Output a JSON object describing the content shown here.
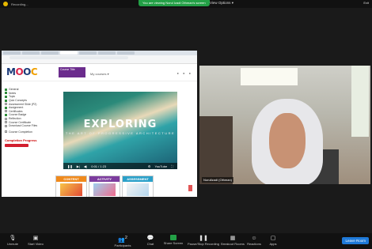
{
  "topbar": {
    "recording": "Recording...",
    "viewing_notice": "You are viewing Norul Izadi Othman's screen",
    "view_options": "View Options",
    "right_text": "Exit"
  },
  "shared_screen": {
    "logo": {
      "m": "M",
      "o": "O",
      "o2": "O",
      "c": "C"
    },
    "course_title": "Course Title",
    "nav_select": "My courses",
    "header_icons": "● ● ●",
    "sidebar_items": [
      "General",
      "Notes",
      "Topic",
      "Quiz Concepts",
      "Assessment Slide (P2)",
      "Assignment",
      "Certificates",
      "Course Badge",
      "Reflection",
      "Course Certificate",
      "Download Course Files"
    ],
    "sidebar_done": [
      true,
      true,
      true,
      true,
      false,
      true,
      false,
      true,
      false,
      false,
      false
    ],
    "sidebar_footer": "Course Completion",
    "completion_title": "Completion Progress",
    "video": {
      "title": "EXPLORING",
      "subtitle": "THE ART OF PROGRESSIVE ARCHITECTURE",
      "time": "0:01 / 1:23",
      "brand": "YouTube"
    },
    "cards": [
      "CONTENT",
      "ACTIVITY",
      "ASSESSMENT"
    ]
  },
  "camera": {
    "name": "NurulIzadi (Othman)"
  },
  "bottom_bar": {
    "unmute": "Unmute",
    "start_video": "Start Video",
    "participants": "Participants",
    "participants_count": "2",
    "chat": "Chat",
    "share_screen": "Share Screen",
    "pause_recording": "Pause/Stop Recording",
    "breakout_rooms": "Breakout Rooms",
    "reactions": "Reactions",
    "apps": "Apps",
    "leave": "Leave Room"
  }
}
